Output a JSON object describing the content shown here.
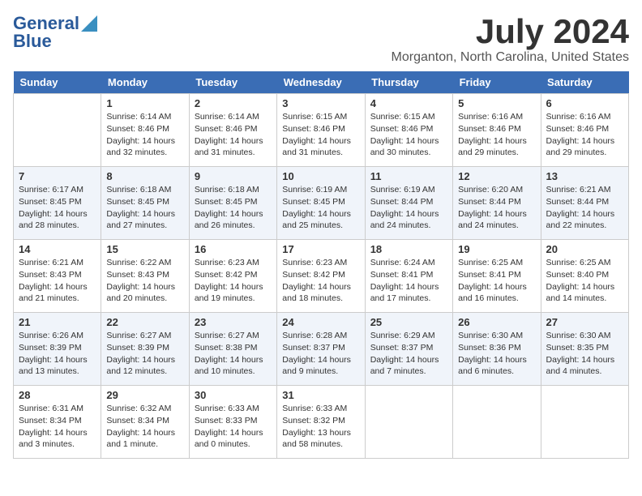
{
  "logo": {
    "line1": "General",
    "line2": "Blue"
  },
  "header": {
    "month": "July 2024",
    "location": "Morganton, North Carolina, United States"
  },
  "weekdays": [
    "Sunday",
    "Monday",
    "Tuesday",
    "Wednesday",
    "Thursday",
    "Friday",
    "Saturday"
  ],
  "weeks": [
    [
      {
        "day": "",
        "sunrise": "",
        "sunset": "",
        "daylight": ""
      },
      {
        "day": "1",
        "sunrise": "Sunrise: 6:14 AM",
        "sunset": "Sunset: 8:46 PM",
        "daylight": "Daylight: 14 hours and 32 minutes."
      },
      {
        "day": "2",
        "sunrise": "Sunrise: 6:14 AM",
        "sunset": "Sunset: 8:46 PM",
        "daylight": "Daylight: 14 hours and 31 minutes."
      },
      {
        "day": "3",
        "sunrise": "Sunrise: 6:15 AM",
        "sunset": "Sunset: 8:46 PM",
        "daylight": "Daylight: 14 hours and 31 minutes."
      },
      {
        "day": "4",
        "sunrise": "Sunrise: 6:15 AM",
        "sunset": "Sunset: 8:46 PM",
        "daylight": "Daylight: 14 hours and 30 minutes."
      },
      {
        "day": "5",
        "sunrise": "Sunrise: 6:16 AM",
        "sunset": "Sunset: 8:46 PM",
        "daylight": "Daylight: 14 hours and 29 minutes."
      },
      {
        "day": "6",
        "sunrise": "Sunrise: 6:16 AM",
        "sunset": "Sunset: 8:46 PM",
        "daylight": "Daylight: 14 hours and 29 minutes."
      }
    ],
    [
      {
        "day": "7",
        "sunrise": "Sunrise: 6:17 AM",
        "sunset": "Sunset: 8:45 PM",
        "daylight": "Daylight: 14 hours and 28 minutes."
      },
      {
        "day": "8",
        "sunrise": "Sunrise: 6:18 AM",
        "sunset": "Sunset: 8:45 PM",
        "daylight": "Daylight: 14 hours and 27 minutes."
      },
      {
        "day": "9",
        "sunrise": "Sunrise: 6:18 AM",
        "sunset": "Sunset: 8:45 PM",
        "daylight": "Daylight: 14 hours and 26 minutes."
      },
      {
        "day": "10",
        "sunrise": "Sunrise: 6:19 AM",
        "sunset": "Sunset: 8:45 PM",
        "daylight": "Daylight: 14 hours and 25 minutes."
      },
      {
        "day": "11",
        "sunrise": "Sunrise: 6:19 AM",
        "sunset": "Sunset: 8:44 PM",
        "daylight": "Daylight: 14 hours and 24 minutes."
      },
      {
        "day": "12",
        "sunrise": "Sunrise: 6:20 AM",
        "sunset": "Sunset: 8:44 PM",
        "daylight": "Daylight: 14 hours and 24 minutes."
      },
      {
        "day": "13",
        "sunrise": "Sunrise: 6:21 AM",
        "sunset": "Sunset: 8:44 PM",
        "daylight": "Daylight: 14 hours and 22 minutes."
      }
    ],
    [
      {
        "day": "14",
        "sunrise": "Sunrise: 6:21 AM",
        "sunset": "Sunset: 8:43 PM",
        "daylight": "Daylight: 14 hours and 21 minutes."
      },
      {
        "day": "15",
        "sunrise": "Sunrise: 6:22 AM",
        "sunset": "Sunset: 8:43 PM",
        "daylight": "Daylight: 14 hours and 20 minutes."
      },
      {
        "day": "16",
        "sunrise": "Sunrise: 6:23 AM",
        "sunset": "Sunset: 8:42 PM",
        "daylight": "Daylight: 14 hours and 19 minutes."
      },
      {
        "day": "17",
        "sunrise": "Sunrise: 6:23 AM",
        "sunset": "Sunset: 8:42 PM",
        "daylight": "Daylight: 14 hours and 18 minutes."
      },
      {
        "day": "18",
        "sunrise": "Sunrise: 6:24 AM",
        "sunset": "Sunset: 8:41 PM",
        "daylight": "Daylight: 14 hours and 17 minutes."
      },
      {
        "day": "19",
        "sunrise": "Sunrise: 6:25 AM",
        "sunset": "Sunset: 8:41 PM",
        "daylight": "Daylight: 14 hours and 16 minutes."
      },
      {
        "day": "20",
        "sunrise": "Sunrise: 6:25 AM",
        "sunset": "Sunset: 8:40 PM",
        "daylight": "Daylight: 14 hours and 14 minutes."
      }
    ],
    [
      {
        "day": "21",
        "sunrise": "Sunrise: 6:26 AM",
        "sunset": "Sunset: 8:39 PM",
        "daylight": "Daylight: 14 hours and 13 minutes."
      },
      {
        "day": "22",
        "sunrise": "Sunrise: 6:27 AM",
        "sunset": "Sunset: 8:39 PM",
        "daylight": "Daylight: 14 hours and 12 minutes."
      },
      {
        "day": "23",
        "sunrise": "Sunrise: 6:27 AM",
        "sunset": "Sunset: 8:38 PM",
        "daylight": "Daylight: 14 hours and 10 minutes."
      },
      {
        "day": "24",
        "sunrise": "Sunrise: 6:28 AM",
        "sunset": "Sunset: 8:37 PM",
        "daylight": "Daylight: 14 hours and 9 minutes."
      },
      {
        "day": "25",
        "sunrise": "Sunrise: 6:29 AM",
        "sunset": "Sunset: 8:37 PM",
        "daylight": "Daylight: 14 hours and 7 minutes."
      },
      {
        "day": "26",
        "sunrise": "Sunrise: 6:30 AM",
        "sunset": "Sunset: 8:36 PM",
        "daylight": "Daylight: 14 hours and 6 minutes."
      },
      {
        "day": "27",
        "sunrise": "Sunrise: 6:30 AM",
        "sunset": "Sunset: 8:35 PM",
        "daylight": "Daylight: 14 hours and 4 minutes."
      }
    ],
    [
      {
        "day": "28",
        "sunrise": "Sunrise: 6:31 AM",
        "sunset": "Sunset: 8:34 PM",
        "daylight": "Daylight: 14 hours and 3 minutes."
      },
      {
        "day": "29",
        "sunrise": "Sunrise: 6:32 AM",
        "sunset": "Sunset: 8:34 PM",
        "daylight": "Daylight: 14 hours and 1 minute."
      },
      {
        "day": "30",
        "sunrise": "Sunrise: 6:33 AM",
        "sunset": "Sunset: 8:33 PM",
        "daylight": "Daylight: 14 hours and 0 minutes."
      },
      {
        "day": "31",
        "sunrise": "Sunrise: 6:33 AM",
        "sunset": "Sunset: 8:32 PM",
        "daylight": "Daylight: 13 hours and 58 minutes."
      },
      {
        "day": "",
        "sunrise": "",
        "sunset": "",
        "daylight": ""
      },
      {
        "day": "",
        "sunrise": "",
        "sunset": "",
        "daylight": ""
      },
      {
        "day": "",
        "sunrise": "",
        "sunset": "",
        "daylight": ""
      }
    ]
  ]
}
